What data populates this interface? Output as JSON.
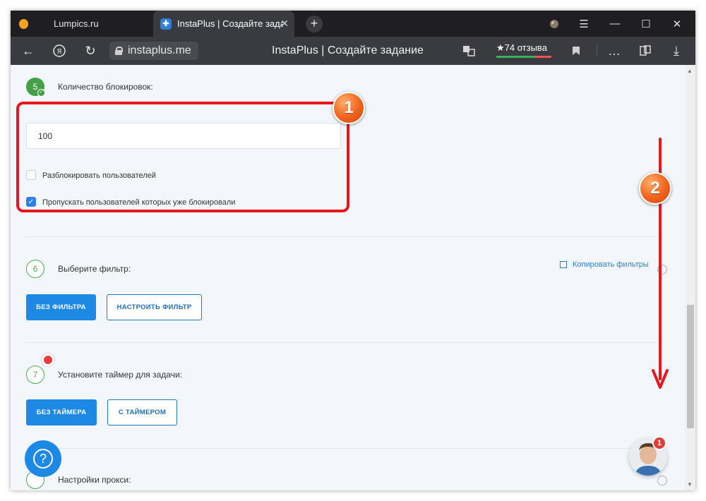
{
  "browser": {
    "tabs": [
      {
        "title": "Lumpics.ru",
        "active": false
      },
      {
        "title": "InstaPlus | Создайте задание",
        "active": true
      }
    ],
    "url": "instaplus.me",
    "page_title": "InstaPlus | Создайте задание",
    "reviews": "★74 отзыва"
  },
  "section5": {
    "number": "5",
    "label": "Количество блокировок:",
    "input_value": "100",
    "checkbox_unblock": {
      "label": "Разблокировать пользователей",
      "checked": false
    },
    "checkbox_skip": {
      "label": "Пропускать пользователей которых уже блокировали",
      "checked": true
    }
  },
  "section6": {
    "number": "6",
    "label": "Выберите фильтр:",
    "copy_filters": "Копировать фильтры",
    "btn_no_filter": "БЕЗ ФИЛЬТРА",
    "btn_configure": "НАСТРОИТЬ ФИЛЬТР"
  },
  "section7": {
    "number": "7",
    "label": "Установите таймер для задачи:",
    "btn_no_timer": "БЕЗ ТАЙМЕРА",
    "btn_with_timer": "С ТАЙМЕРОМ"
  },
  "section8": {
    "label": "Настройки прокси:"
  },
  "chat": {
    "badge": "1"
  },
  "help": {
    "icon_text": "?"
  },
  "annotations": {
    "callout1": "1",
    "callout2": "2",
    "color": "#e8161d"
  }
}
